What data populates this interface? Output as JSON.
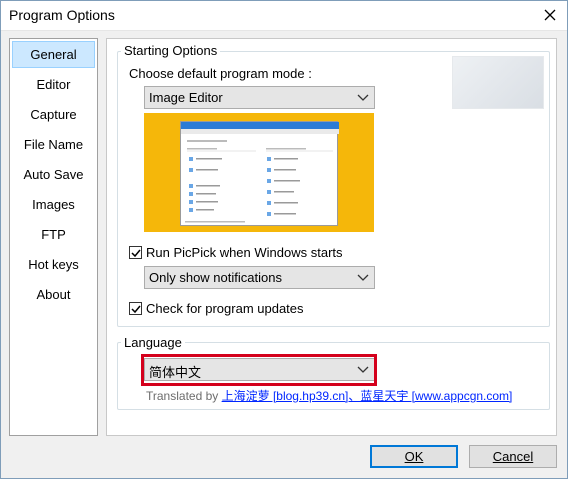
{
  "window": {
    "title": "Program Options"
  },
  "sidebar": {
    "items": [
      {
        "label": "General",
        "active": true
      },
      {
        "label": "Editor"
      },
      {
        "label": "Capture"
      },
      {
        "label": "File Name"
      },
      {
        "label": "Auto Save"
      },
      {
        "label": "Images"
      },
      {
        "label": "FTP"
      },
      {
        "label": "Hot keys"
      },
      {
        "label": "About"
      }
    ]
  },
  "starting": {
    "legend": "Starting Options",
    "mode_label": "Choose default program mode :",
    "mode_value": "Image Editor",
    "run_label": "Run PicPick when Windows starts",
    "run_checked": true,
    "notif_value": "Only show notifications",
    "updates_label": "Check for program updates",
    "updates_checked": true
  },
  "language": {
    "legend": "Language",
    "value": "简体中文",
    "translated_prefix": "Translated by",
    "translators": "上海淀萝 [blog.hp39.cn]、蓝星天宇 [www.appcgn.com]",
    "highlight_color": "#d4001c"
  },
  "buttons": {
    "ok": "OK",
    "cancel": "Cancel"
  },
  "colors": {
    "accent": "#0078d7",
    "selection": "#cce8ff",
    "preview_bg": "#f5b70a"
  }
}
